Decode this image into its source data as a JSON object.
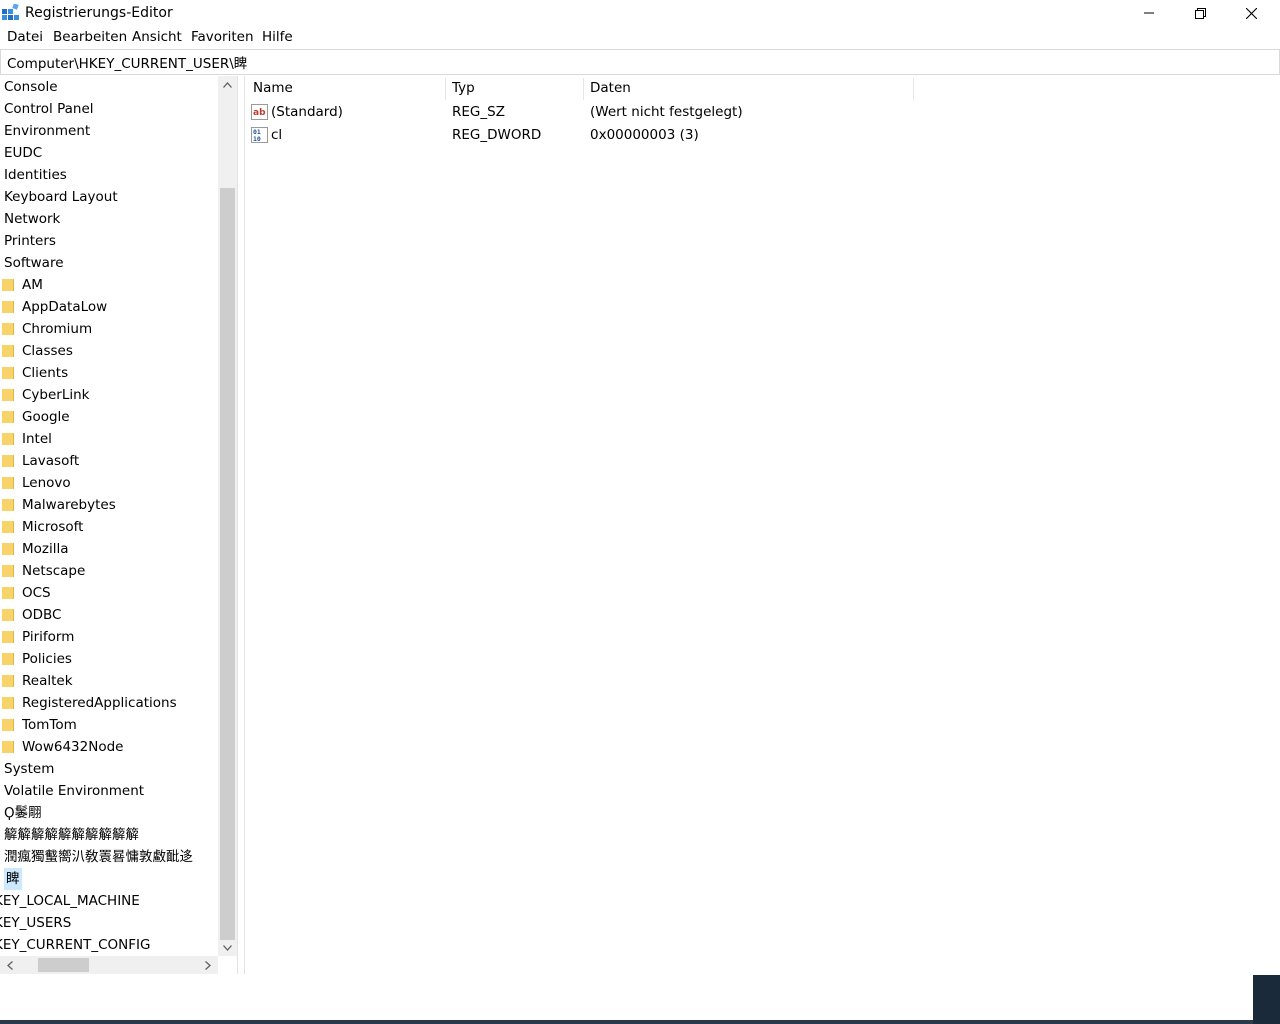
{
  "window": {
    "title": "Registrierungs-Editor",
    "minimize_icon": "minimize-icon",
    "maximize_icon": "restore-icon",
    "close_icon": "close-icon"
  },
  "menu": {
    "file": "Datei",
    "edit": "Bearbeiten",
    "view": "Ansicht",
    "favorites": "Favoriten",
    "help": "Hilfe"
  },
  "address": {
    "value": "Computer\\HKEY_CURRENT_USER\\睥"
  },
  "tree": {
    "items": [
      {
        "label": "Console",
        "folder": false
      },
      {
        "label": "Control Panel",
        "folder": false
      },
      {
        "label": "Environment",
        "folder": false
      },
      {
        "label": "EUDC",
        "folder": false
      },
      {
        "label": "Identities",
        "folder": false
      },
      {
        "label": "Keyboard Layout",
        "folder": false
      },
      {
        "label": "Network",
        "folder": false
      },
      {
        "label": "Printers",
        "folder": false
      },
      {
        "label": "Software",
        "folder": false
      },
      {
        "label": "AM",
        "folder": true
      },
      {
        "label": "AppDataLow",
        "folder": true
      },
      {
        "label": "Chromium",
        "folder": true
      },
      {
        "label": "Classes",
        "folder": true
      },
      {
        "label": "Clients",
        "folder": true
      },
      {
        "label": "CyberLink",
        "folder": true
      },
      {
        "label": "Google",
        "folder": true
      },
      {
        "label": "Intel",
        "folder": true
      },
      {
        "label": "Lavasoft",
        "folder": true
      },
      {
        "label": "Lenovo",
        "folder": true
      },
      {
        "label": "Malwarebytes",
        "folder": true
      },
      {
        "label": "Microsoft",
        "folder": true
      },
      {
        "label": "Mozilla",
        "folder": true
      },
      {
        "label": "Netscape",
        "folder": true
      },
      {
        "label": "OCS",
        "folder": true
      },
      {
        "label": "ODBC",
        "folder": true
      },
      {
        "label": "Piriform",
        "folder": true
      },
      {
        "label": "Policies",
        "folder": true
      },
      {
        "label": "Realtek",
        "folder": true
      },
      {
        "label": "RegisteredApplications",
        "folder": true
      },
      {
        "label": "TomTom",
        "folder": true
      },
      {
        "label": "Wow6432Node",
        "folder": true
      },
      {
        "label": "System",
        "folder": false
      },
      {
        "label": "Volatile Environment",
        "folder": false
      },
      {
        "label": "Ϙ䰀翢",
        "folder": false
      },
      {
        "label": "䉏䉏䉏䉏䉏䉏䉏䉏䉏䉏",
        "folder": false
      },
      {
        "label": "潤瘋獨䘁嚮汃敎瞏晷慵敦䲣䩃迻",
        "folder": false
      },
      {
        "label": "睥",
        "folder": false,
        "selected": true
      },
      {
        "label": "KEY_LOCAL_MACHINE",
        "folder": false
      },
      {
        "label": "KEY_USERS",
        "folder": false
      },
      {
        "label": "KEY_CURRENT_CONFIG",
        "folder": false
      }
    ]
  },
  "list": {
    "columns": [
      "Name",
      "Typ",
      "Daten"
    ],
    "rows": [
      {
        "icon": "string-value-icon",
        "name": "(Standard)",
        "type": "REG_SZ",
        "data": "(Wert nicht festgelegt)"
      },
      {
        "icon": "dword-value-icon",
        "name": "cl",
        "type": "REG_DWORD",
        "data": "0x00000003 (3)"
      }
    ]
  },
  "colors": {
    "selection": "#cce8ff",
    "folder": "#f8d36a",
    "scroll_track": "#f0f0f0",
    "scroll_thumb": "#cdcdcd"
  }
}
